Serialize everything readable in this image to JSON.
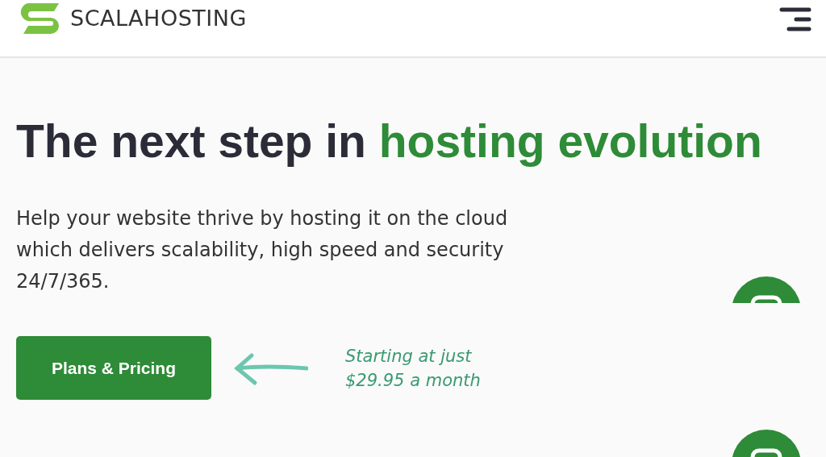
{
  "header": {
    "brand": "SCALAHOSTING"
  },
  "hero": {
    "title_lead": "The next step in",
    "title_highlight": "hosting evolution",
    "description": "Help your website thrive by hosting it on the cloud which delivers scalability, high speed and security 24/7/365.",
    "button": "Plans & Pricing",
    "note_lines": [
      "Starting at just",
      "$29.95 a month"
    ]
  }
}
